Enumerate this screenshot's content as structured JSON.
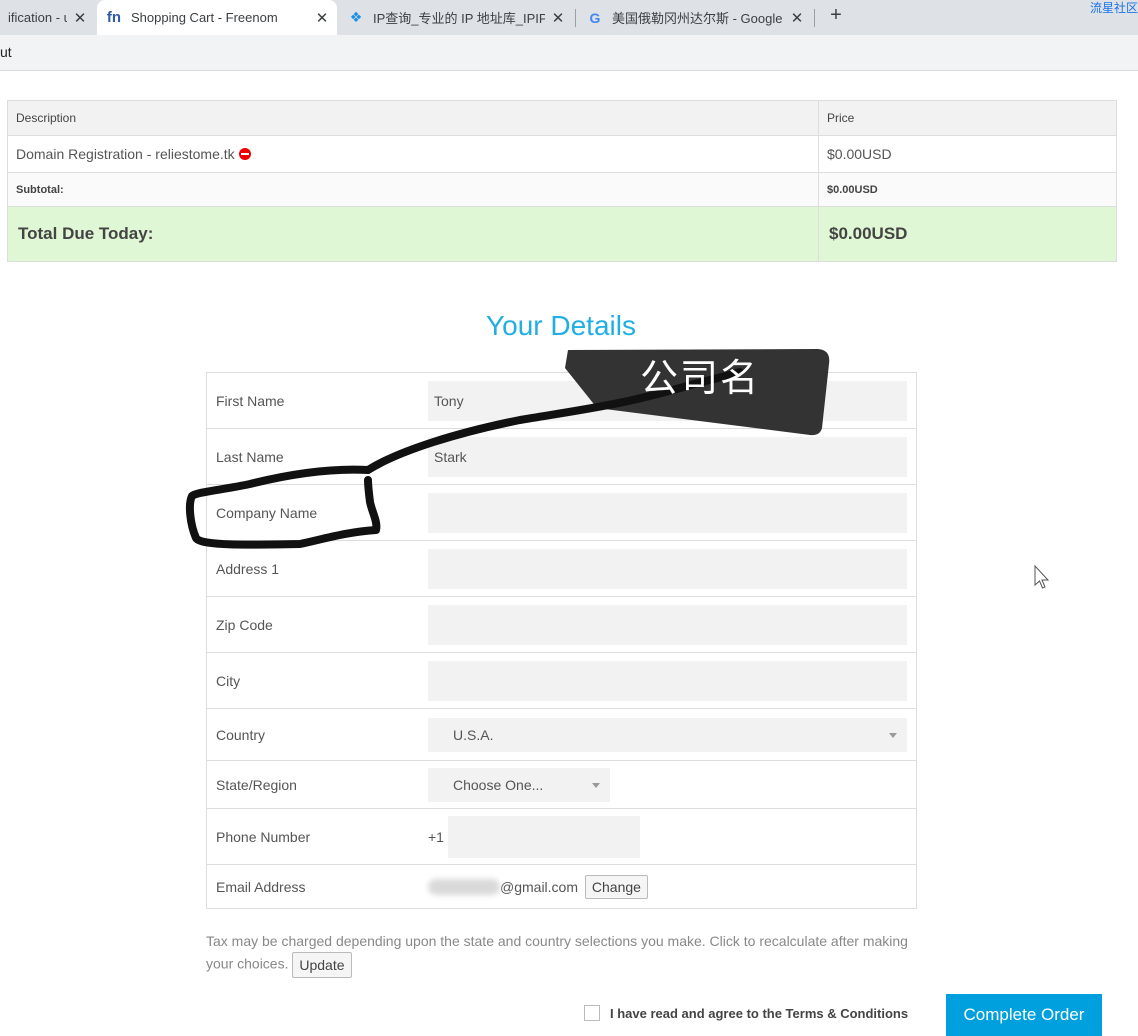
{
  "browser": {
    "tabs": [
      {
        "title": "ification - u",
        "favicon": "partial-tab-icon",
        "active": false
      },
      {
        "title": "Shopping Cart - Freenom",
        "favicon_text": "fn",
        "active": true
      },
      {
        "title": "IP查询_专业的 IP 地址库_IPIP.NE",
        "favicon": "ipip-icon",
        "active": false
      },
      {
        "title": "美国俄勒冈州达尔斯 - Google 搜",
        "favicon_text": "G",
        "active": false
      }
    ],
    "corner_text": "流星社区",
    "address_fragment": "ut"
  },
  "cart": {
    "headers": {
      "description": "Description",
      "price": "Price"
    },
    "item": {
      "description": "Domain Registration - reliestome.tk",
      "price": "$0.00USD"
    },
    "subtotal": {
      "label": "Subtotal:",
      "value": "$0.00USD"
    },
    "total": {
      "label": "Total Due Today:",
      "value": "$0.00USD"
    }
  },
  "details": {
    "title": "Your Details",
    "fields": {
      "first_name": {
        "label": "First Name",
        "value": "Tony"
      },
      "last_name": {
        "label": "Last Name",
        "value": "Stark"
      },
      "company_name": {
        "label": "Company Name",
        "value": ""
      },
      "address1": {
        "label": "Address 1",
        "value": ""
      },
      "zip": {
        "label": "Zip Code",
        "value": ""
      },
      "city": {
        "label": "City",
        "value": ""
      },
      "country": {
        "label": "Country",
        "value": "U.S.A."
      },
      "state": {
        "label": "State/Region",
        "value": "Choose One..."
      },
      "phone": {
        "label": "Phone Number",
        "prefix": "+1",
        "value": ""
      },
      "email": {
        "label": "Email Address",
        "value": "@gmail.com",
        "change_label": "Change"
      }
    }
  },
  "tax_note": {
    "text": "Tax may be charged depending upon the state and country selections you make. Click to recalculate after making your choices.",
    "update_label": "Update"
  },
  "terms": {
    "label": "I have read and agree to the Terms & Conditions"
  },
  "complete_button": "Complete Order",
  "annotation": {
    "text": "公司名",
    "color": "#333333"
  },
  "colors": {
    "accent": "#21aee3",
    "button": "#00a0df",
    "total_bg": "#dff7d4"
  }
}
